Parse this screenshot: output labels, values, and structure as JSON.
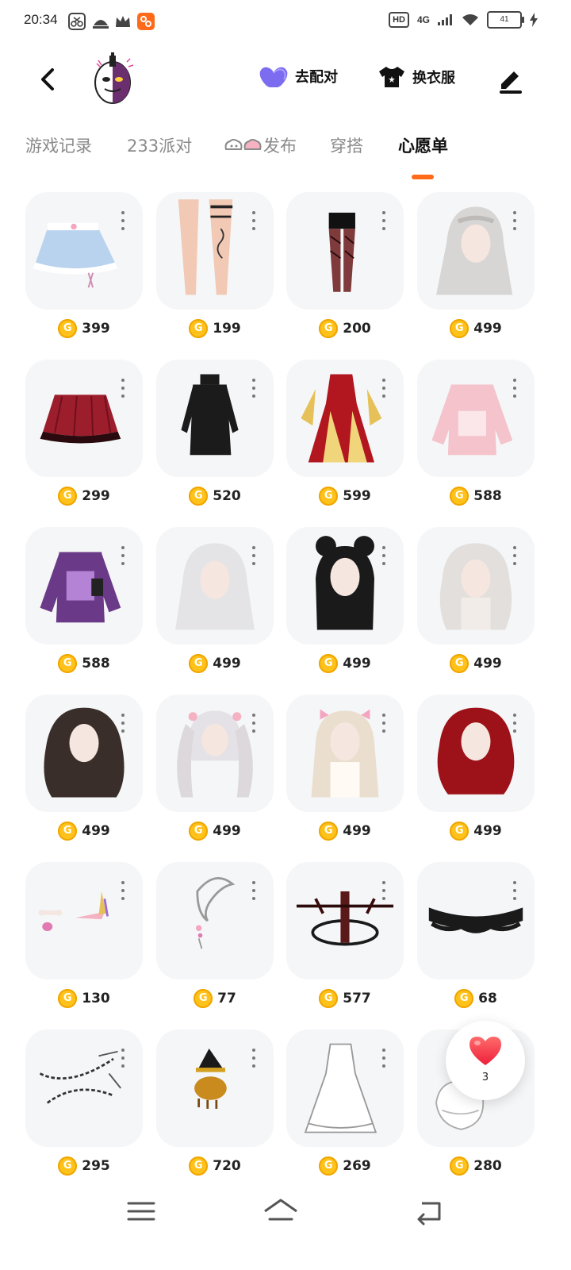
{
  "status_bar": {
    "time": "20:34",
    "hd": "HD",
    "network": "4G",
    "battery": "41",
    "icons": [
      "scissors-app-icon",
      "notification-icon",
      "crown-icon",
      "app-badge-icon",
      "signal-icon",
      "wifi-icon",
      "battery-icon",
      "charging-icon"
    ]
  },
  "header": {
    "back_icon": "chevron-left-icon",
    "match_label": "去配对",
    "match_icon": "heart-icon",
    "outfit_label": "换衣服",
    "outfit_icon": "tshirt-icon",
    "edit_icon": "pencil-icon"
  },
  "tabs": [
    {
      "label": "游戏记录",
      "active": false
    },
    {
      "label": "233派对",
      "active": false
    },
    {
      "label": "发布",
      "active": false,
      "prefix_icon": "cloud-eye-icon"
    },
    {
      "label": "穿搭",
      "active": false
    },
    {
      "label": "心愿单",
      "active": true
    }
  ],
  "colors": {
    "accent": "#ff6a1a",
    "coin": "#ffc21a",
    "card_bg": "#f5f6f8",
    "heart": "#7b6cf0",
    "like": "#ff3b47"
  },
  "wishlist": [
    {
      "name": "blue-frilly-skirt",
      "price": "399"
    },
    {
      "name": "leg-tattoo-garter",
      "price": "199"
    },
    {
      "name": "black-lace-stockings",
      "price": "200"
    },
    {
      "name": "long-silver-hair",
      "price": "499"
    },
    {
      "name": "red-plaid-skirt",
      "price": "299"
    },
    {
      "name": "black-turtleneck-dress",
      "price": "520"
    },
    {
      "name": "red-gold-gown",
      "price": "599"
    },
    {
      "name": "pink-oversized-sweater",
      "price": "588"
    },
    {
      "name": "purple-graphic-sweater",
      "price": "588"
    },
    {
      "name": "white-long-hair",
      "price": "499"
    },
    {
      "name": "black-bun-hair",
      "price": "499"
    },
    {
      "name": "white-wavy-hair",
      "price": "499"
    },
    {
      "name": "dark-brown-wavy-hair",
      "price": "499"
    },
    {
      "name": "silver-twin-tails",
      "price": "499"
    },
    {
      "name": "blonde-twin-tails",
      "price": "499"
    },
    {
      "name": "red-layered-hair",
      "price": "499"
    },
    {
      "name": "bone-ribbon-accessories",
      "price": "130"
    },
    {
      "name": "silver-earring",
      "price": "77"
    },
    {
      "name": "dark-halo-crown",
      "price": "577"
    },
    {
      "name": "black-lace-choker",
      "price": "68"
    },
    {
      "name": "chain-accessory",
      "price": "295"
    },
    {
      "name": "witch-hat-pet",
      "price": "720"
    },
    {
      "name": "white-lace-dress",
      "price": "269"
    },
    {
      "name": "white-fluffy-item",
      "price": "280"
    }
  ],
  "like_fab": {
    "icon": "heart-like-icon",
    "count": "3"
  },
  "nav_bar": {
    "menu_icon": "menu-icon",
    "home_icon": "home-icon",
    "back_icon": "back-arrow-icon"
  }
}
